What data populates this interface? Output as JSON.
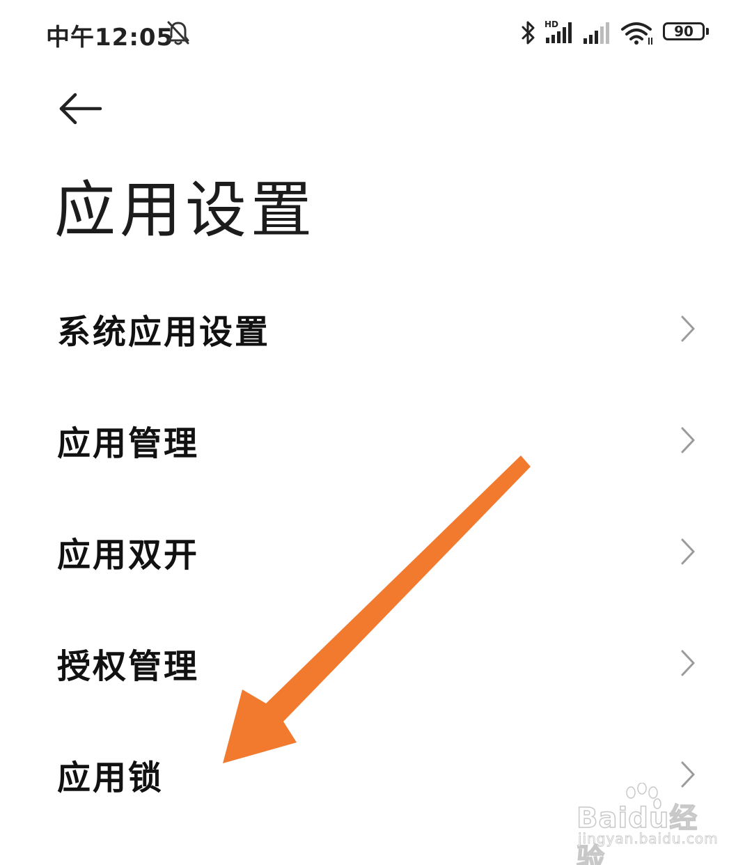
{
  "status_bar": {
    "time": "中午12:05",
    "battery_level": "90",
    "network_badge": "HD",
    "icons": [
      "bell-off-icon",
      "bluetooth-icon",
      "signal-hd-icon",
      "signal-icon",
      "wifi-icon",
      "battery-icon"
    ]
  },
  "header": {
    "back_icon": "arrow-left-icon",
    "title": "应用设置"
  },
  "settings": {
    "items": [
      {
        "label": "系统应用设置",
        "icon": "chevron-right-icon"
      },
      {
        "label": "应用管理",
        "icon": "chevron-right-icon"
      },
      {
        "label": "应用双开",
        "icon": "chevron-right-icon"
      },
      {
        "label": "授权管理",
        "icon": "chevron-right-icon"
      },
      {
        "label": "应用锁",
        "icon": "chevron-right-icon"
      }
    ]
  },
  "annotation": {
    "arrow_color": "#F27A2F",
    "points_to": "应用锁"
  },
  "watermark": {
    "brand": "Baidu经验",
    "url": "jingyan.baidu.com"
  },
  "colors": {
    "text_primary": "#111111",
    "chevron": "#9a9a9a",
    "background": "#ffffff"
  }
}
